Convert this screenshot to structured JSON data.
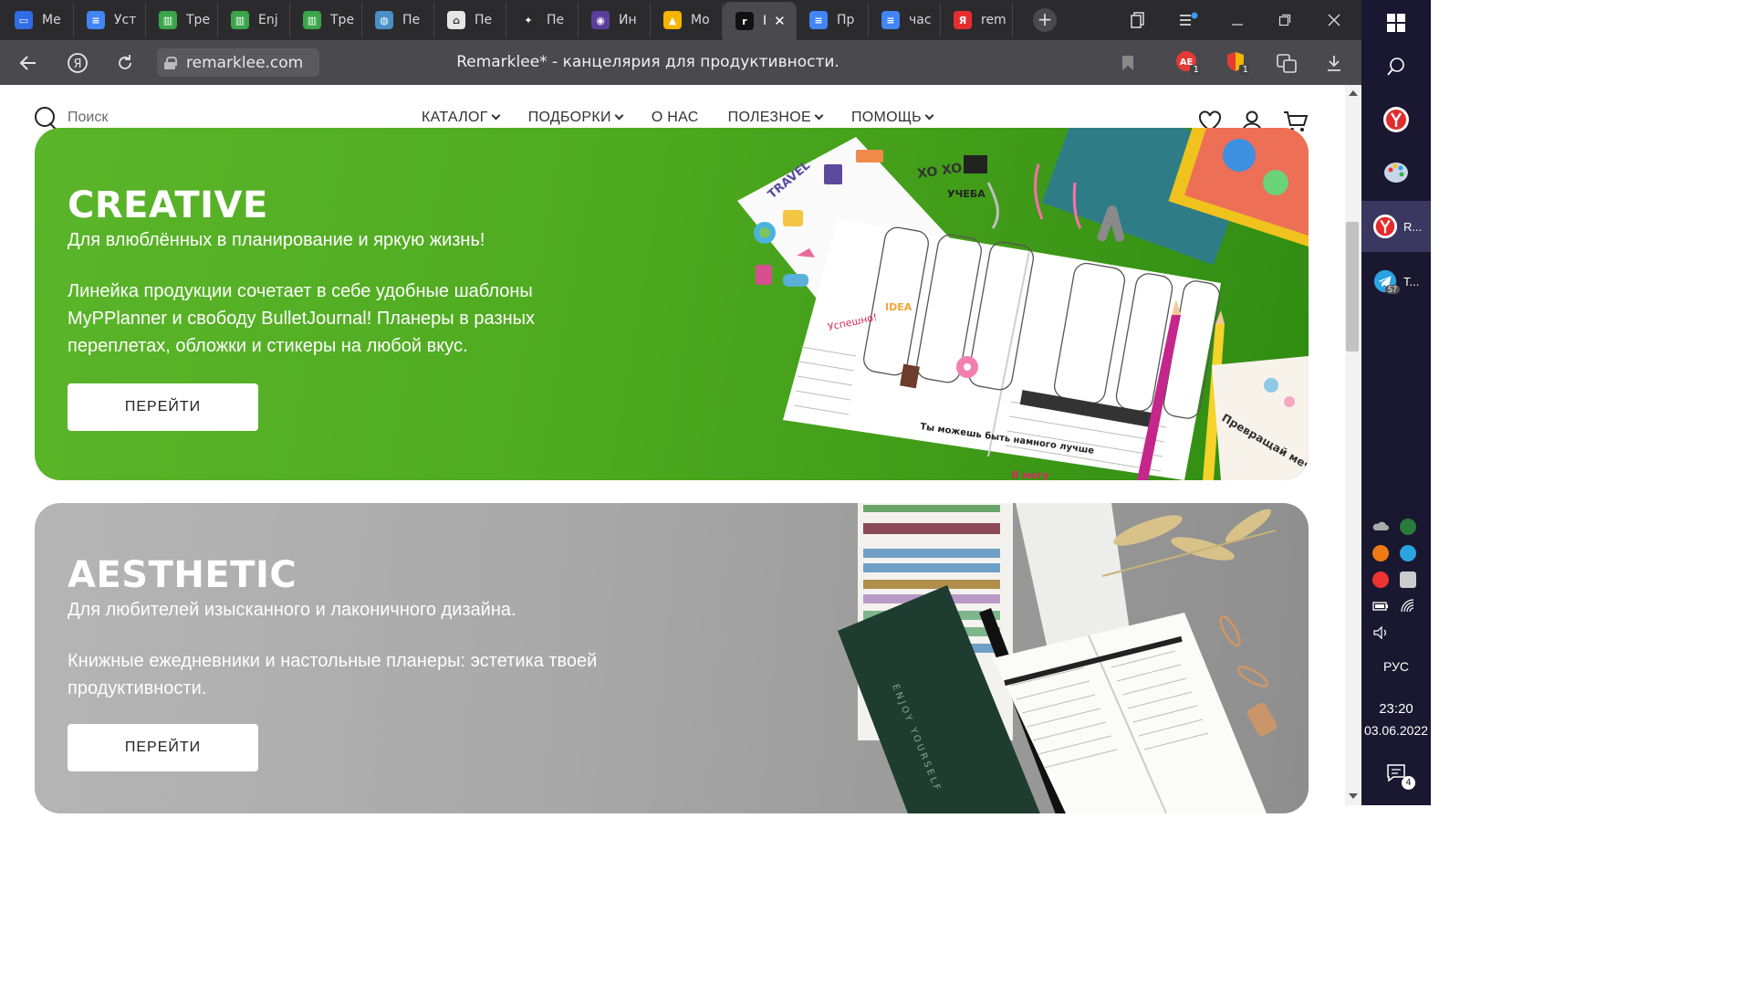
{
  "browser": {
    "tabs": [
      {
        "label": "Ме",
        "fav_color": "#2f6ce5",
        "fav_glyph": "▭"
      },
      {
        "label": "Уст",
        "fav_color": "#4285f4",
        "fav_glyph": "≡"
      },
      {
        "label": "Тре",
        "fav_color": "#3ba54a",
        "fav_glyph": "▥"
      },
      {
        "label": "Enj",
        "fav_color": "#3ba54a",
        "fav_glyph": "▥"
      },
      {
        "label": "Тре",
        "fav_color": "#3ba54a",
        "fav_glyph": "▥"
      },
      {
        "label": "Пе",
        "fav_color": "#4a90c8",
        "fav_glyph": "◍"
      },
      {
        "label": "Пе",
        "fav_color": "#e6e6e6",
        "fav_glyph": "⌂"
      },
      {
        "label": "Пе",
        "fav_color": "#2a2a2a",
        "fav_glyph": "✦"
      },
      {
        "label": "Ин",
        "fav_color": "#5b3e9c",
        "fav_glyph": "◉"
      },
      {
        "label": "Мо",
        "fav_color": "#f4b400",
        "fav_glyph": "▲"
      },
      {
        "label": "I",
        "fav_color": "#111111",
        "fav_glyph": "r",
        "active": true
      },
      {
        "label": "Пр",
        "fav_color": "#4285f4",
        "fav_glyph": "≡"
      },
      {
        "label": "час",
        "fav_color": "#4285f4",
        "fav_glyph": "≡"
      },
      {
        "label": "rem",
        "fav_color": "#e62e2e",
        "fav_glyph": "Я"
      }
    ],
    "url": "remarklee.com",
    "page_title": "Remarklee* - канцелярия для продуктивности.",
    "ext_badge_1": "1",
    "ext_badge_2": "1"
  },
  "site": {
    "search_placeholder": "Поиск",
    "menu": [
      {
        "label": "КАТАЛОГ",
        "dropdown": true
      },
      {
        "label": "ПОДБОРКИ",
        "dropdown": true
      },
      {
        "label": "О НАС",
        "dropdown": false
      },
      {
        "label": "ПОЛЕЗНОЕ",
        "dropdown": true
      },
      {
        "label": "ПОМОЩЬ",
        "dropdown": true
      }
    ]
  },
  "banners": {
    "creative": {
      "title": "CREATIVE",
      "subtitle": "Для влюблённых в планирование и яркую жизнь!",
      "description": "Линейка продукции сочетает в себе удобные шаблоны MyPPlanner и свободу BulletJournal! Планеры в разных переплетах, обложки и стикеры на любой вкус.",
      "button": "ПЕРЕЙТИ",
      "photo_labels": [
        "TRAVEL",
        "XO XO",
        "УЧЕБА",
        "IDEA",
        "Успешно!",
        "Ты можешь быть намного лучше",
        "Превращай мечты",
        "Я могу"
      ]
    },
    "aesthetic": {
      "title": "AESTHETIC",
      "subtitle": "Для любителей изысканного и лаконичного дизайна.",
      "description": "Книжные ежедневники и настольные планеры: эстетика твоей продуктивности.",
      "button": "ПЕРЕЙТИ",
      "photo_labels": [
        "ENJOY YOURSELF"
      ]
    }
  },
  "taskbar": {
    "apps": [
      {
        "label": "R...",
        "active": true
      },
      {
        "label": "T...",
        "badge": "57"
      }
    ],
    "language": "РУС",
    "time": "23:20",
    "date": "03.06.2022",
    "notifications": "4"
  }
}
